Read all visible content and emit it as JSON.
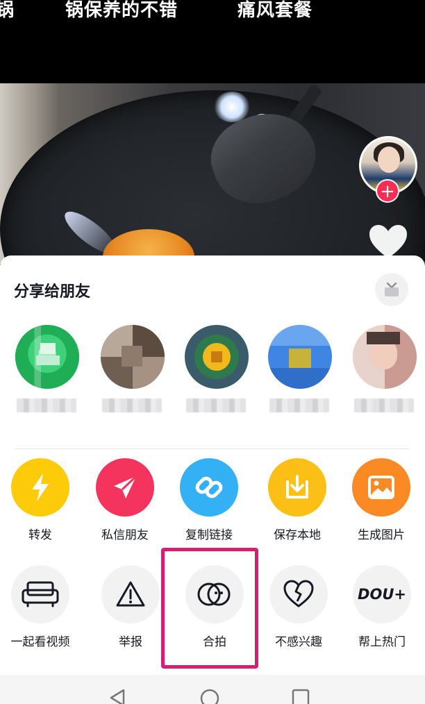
{
  "video": {
    "captions": [
      "锅",
      "锅保养的不错",
      "痛风套餐"
    ],
    "follow_symbol": "+"
  },
  "share_sheet": {
    "title": "分享给朋友",
    "friends": [
      {
        "name": "",
        "avatar_color": "#2fc46a"
      },
      {
        "name": "",
        "avatar_color": "#8a7a6a"
      },
      {
        "name": "",
        "avatar_color": "#e9b21e"
      },
      {
        "name": "",
        "avatar_color": "#3f86e4"
      },
      {
        "name": "",
        "avatar_color": "#d9b7ae"
      }
    ],
    "actions_row1": [
      {
        "label": "转发",
        "icon": "lightning-icon",
        "color": "#fecb0b"
      },
      {
        "label": "私信朋友",
        "icon": "paper-plane-icon",
        "color": "#f4345d"
      },
      {
        "label": "复制链接",
        "icon": "link-icon",
        "color": "#34b1f5"
      },
      {
        "label": "保存本地",
        "icon": "download-icon",
        "color": "#fcbf16"
      },
      {
        "label": "生成图片",
        "icon": "image-icon",
        "color": "#fb8a25"
      }
    ],
    "actions_row2": [
      {
        "label": "一起看视频",
        "icon": "sofa-icon"
      },
      {
        "label": "举报",
        "icon": "warning-icon"
      },
      {
        "label": "合拍",
        "icon": "duet-icon"
      },
      {
        "label": "不感兴趣",
        "icon": "broken-heart-icon"
      },
      {
        "label": "帮上热门",
        "icon": "dou-plus-icon",
        "icon_text": "DOU+"
      }
    ],
    "highlight_color": "#d61e74"
  }
}
